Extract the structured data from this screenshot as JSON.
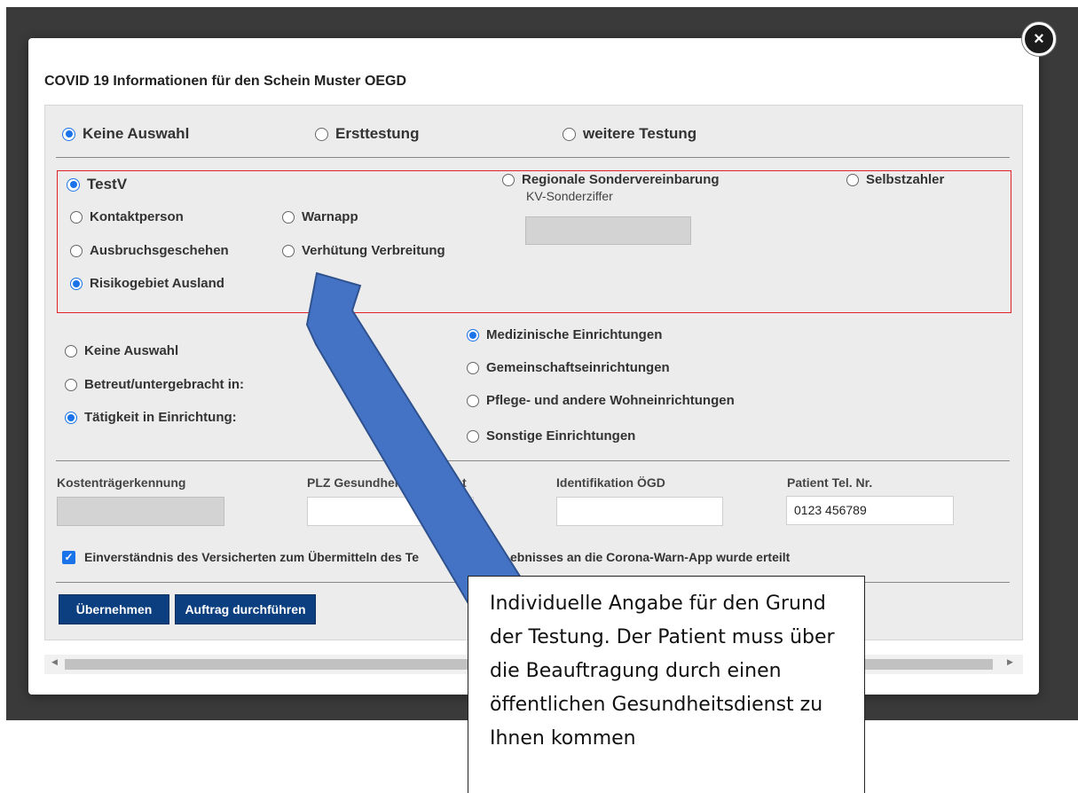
{
  "modal": {
    "title": "COVID 19 Informationen für den Schein Muster OEGD",
    "close_icon": "close-icon"
  },
  "test_type": {
    "options": [
      "Keine Auswahl",
      "Ersttestung",
      "weitere Testung"
    ],
    "selected": "Keine Auswahl"
  },
  "billing": {
    "testv_label": "TestV",
    "regional_label": "Regionale Sondervereinbarung",
    "kv_label": "KV-Sonderziffer",
    "selbstzahler_label": "Selbstzahler",
    "reasons": [
      "Kontaktperson",
      "Warnapp",
      "Ausbruchsgeschehen",
      "Verhütung Verbreitung",
      "Risikogebiet Ausland"
    ],
    "selected_reason": "Risikogebiet Ausland"
  },
  "institution": {
    "left_options": [
      "Keine Auswahl",
      "Betreut/untergebracht in:",
      "Tätigkeit in Einrichtung:"
    ],
    "left_selected": "Tätigkeit in Einrichtung:",
    "right_options": [
      "Medizinische Einrichtungen",
      "Gemeinschaftseinrichtungen",
      "Pflege- und andere Wohneinrichtungen",
      "Sonstige Einrichtungen"
    ],
    "right_selected": "Medizinische Einrichtungen"
  },
  "fields": {
    "kostentraeger_label": "Kostenträgerkennung",
    "plz_label": "PLZ Gesundheits",
    "plz_label_tail": "t",
    "identifikation_label": "Identifikation ÖGD",
    "tel_label": "Patient Tel. Nr.",
    "tel_value": "0123 456789"
  },
  "consent": {
    "label_part1": "Einverständnis des Versicherten zum Übermitteln des Te",
    "label_part2": "ebnisses an die Corona-Warn-App wurde erteilt",
    "checked": true
  },
  "buttons": {
    "uebernehmen": "Übernehmen",
    "auftrag": "Auftrag durchführen"
  },
  "callout": {
    "text": "Individuelle Angabe für den Grund der Testung. Der Patient muss über die Beauftragung durch einen öffentlichen Gesundheitsdienst zu Ihnen kommen"
  },
  "colors": {
    "accent": "#1a73e8",
    "button": "#0b3f80",
    "highlight_border": "#e0212b",
    "arrow": "#4472c4"
  }
}
